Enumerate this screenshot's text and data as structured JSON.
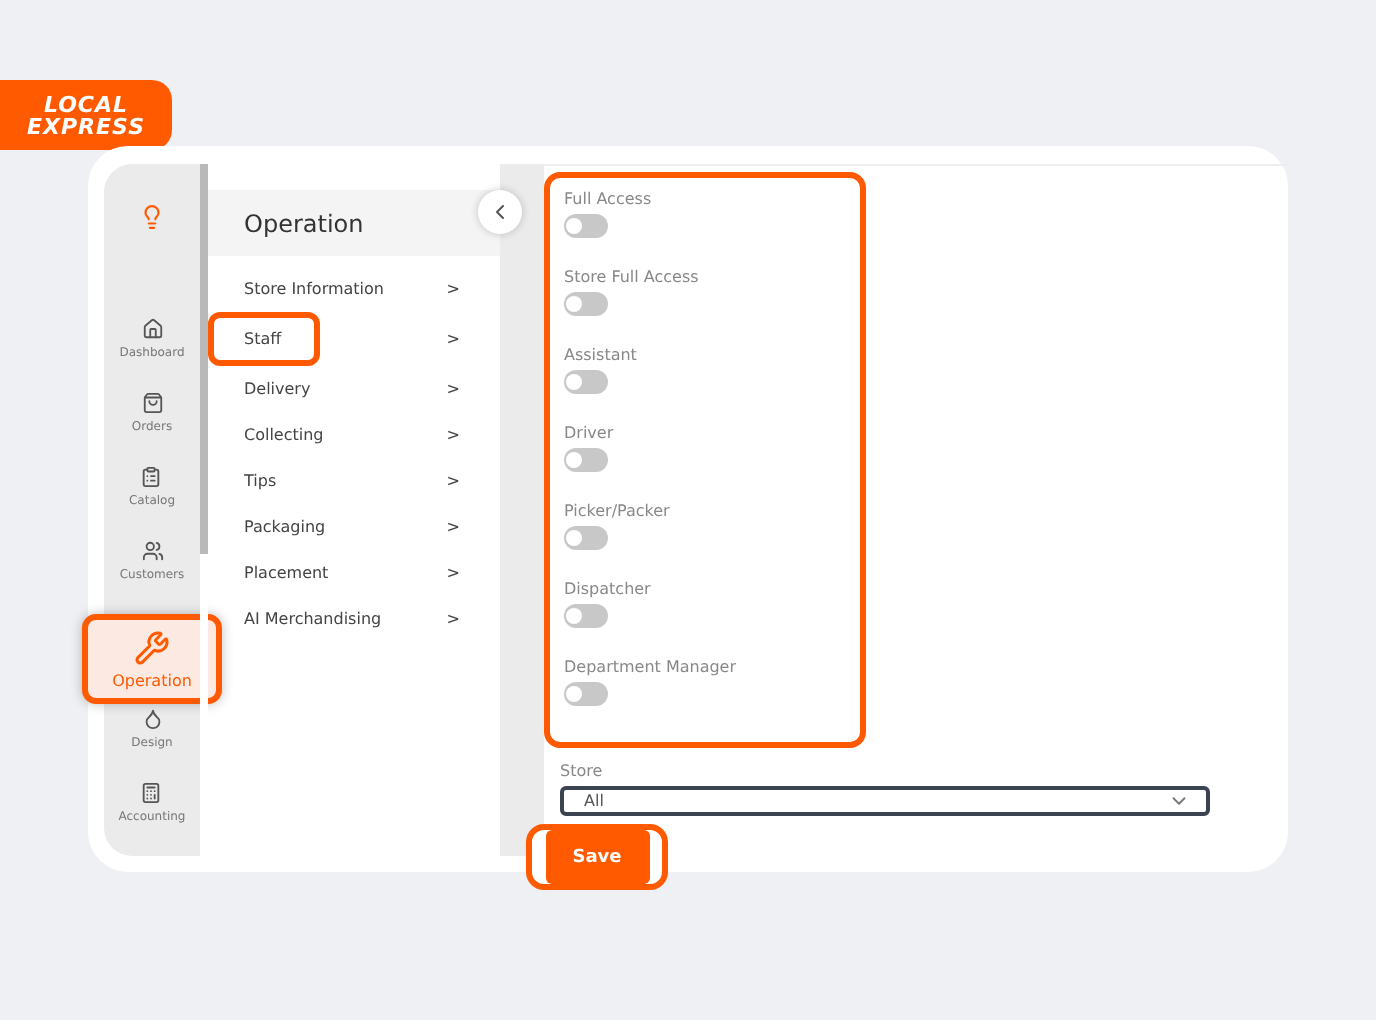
{
  "logo": {
    "line_1": "LOCAL",
    "line_2": "EXPRESS"
  },
  "nav": [
    {
      "label": "Dashboard",
      "selected": false
    },
    {
      "label": "Orders",
      "selected": false
    },
    {
      "label": "Catalog",
      "selected": false
    },
    {
      "label": "Customers",
      "selected": false
    },
    {
      "label": "Operation",
      "selected": true
    },
    {
      "label": "Design",
      "selected": false
    },
    {
      "label": "Accounting",
      "selected": false
    }
  ],
  "submenu": {
    "title": "Operation",
    "items": [
      {
        "label": "Store Information",
        "arrow": ">",
        "highlighted": false
      },
      {
        "label": "Staff",
        "arrow": ">",
        "highlighted": true
      },
      {
        "label": "Delivery",
        "arrow": ">",
        "highlighted": false
      },
      {
        "label": "Collecting",
        "arrow": ">",
        "highlighted": false
      },
      {
        "label": "Tips",
        "arrow": ">",
        "highlighted": false
      },
      {
        "label": "Packaging",
        "arrow": ">",
        "highlighted": false
      },
      {
        "label": "Placement",
        "arrow": ">",
        "highlighted": false
      },
      {
        "label": "AI Merchandising",
        "arrow": ">",
        "highlighted": false
      }
    ]
  },
  "permissions": {
    "highlighted": true,
    "items": [
      {
        "label": "Full Access",
        "on": false
      },
      {
        "label": "Store Full Access",
        "on": false
      },
      {
        "label": "Assistant",
        "on": false
      },
      {
        "label": "Driver",
        "on": false
      },
      {
        "label": "Picker/Packer",
        "on": false
      },
      {
        "label": "Dispatcher",
        "on": false
      },
      {
        "label": "Department Manager",
        "on": false
      }
    ]
  },
  "store": {
    "label": "Store",
    "value": "All"
  },
  "save_button": {
    "label": "Save",
    "highlighted": true
  }
}
